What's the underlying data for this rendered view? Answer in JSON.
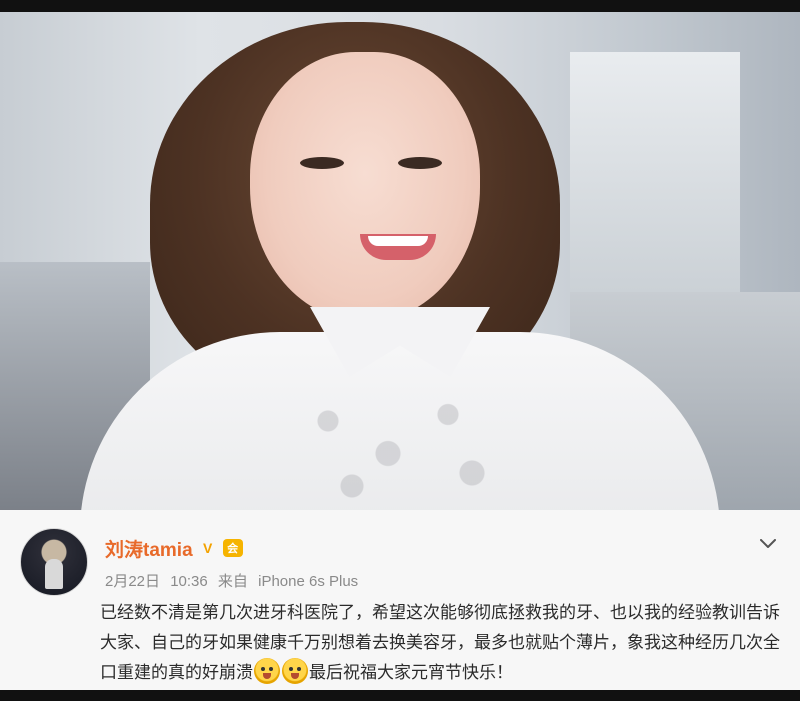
{
  "post": {
    "username": "刘涛tamia",
    "verified_badge": "V",
    "member_badge": "会",
    "date": "2月22日",
    "time": "10:36",
    "source_prefix": "来自",
    "source_device": "iPhone 6s Plus",
    "content_part1": "已经数不清是第几次进牙科医院了，希望这次能够彻底拯救我的牙、也以我的经验教训告诉大家、自己的牙如果健康千万别想着去换美容牙，最多也就贴个薄片，象我这种经历几次全口重建的真的好崩溃",
    "content_part2": "最后祝福大家元宵节快乐！",
    "emojis": [
      "crying-face-emoji",
      "crying-face-emoji"
    ]
  },
  "icons": {
    "chevron": "chevron-down-icon",
    "avatar": "avatar"
  },
  "colors": {
    "username": "#e86a2a",
    "meta": "#8a8a8a",
    "text": "#2b2b2b",
    "card_bg": "#f7f7f7"
  }
}
